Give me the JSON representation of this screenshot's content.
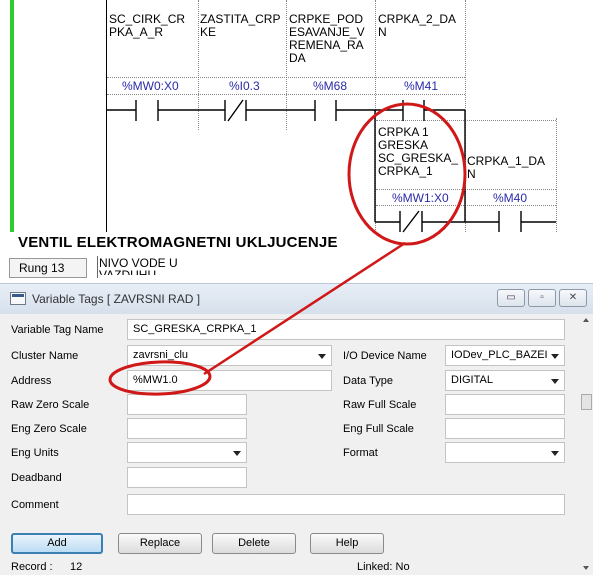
{
  "ladder": {
    "tags": [
      {
        "lines": [
          "SC_CIRK_CR",
          "PKA_A_R"
        ]
      },
      {
        "lines": [
          "ZASTITA_CRP",
          "KE"
        ]
      },
      {
        "lines": [
          "CRPKE_POD",
          "ESAVANJE_V",
          "REMENA_RA",
          "DA"
        ]
      },
      {
        "lines": [
          "CRPKA_2_DA",
          "N"
        ]
      }
    ],
    "addresses": [
      "%MW0:X0",
      "%I0.3",
      "%M68",
      "%M41"
    ],
    "branch_tags": [
      {
        "lines": [
          "CRPKA 1",
          "GRESKA",
          "SC_GRESKA_",
          "CRPKA_1"
        ]
      },
      {
        "lines": [
          "CRPKA_1_DA",
          "N"
        ]
      }
    ],
    "branch_addresses": [
      "%MW1:X0",
      "%M40"
    ],
    "section_title": "VENTIL ELEKTROMAGNETNI UKLJUCENJE",
    "rung_label": "Rung 13",
    "rung_comment": [
      "NIVO VODE U",
      "VAZDUHU..."
    ]
  },
  "dialog": {
    "title": "Variable Tags [ ZAVRSNI RAD ]",
    "window_buttons": {
      "minimize": "▭",
      "restore": "▫",
      "close": "✕"
    },
    "fields": {
      "variable_tag_name": {
        "label": "Variable Tag Name",
        "value": "SC_GRESKA_CRPKA_1"
      },
      "cluster_name": {
        "label": "Cluster Name",
        "value": "zavrsni_clu"
      },
      "io_device_name": {
        "label": "I/O Device Name",
        "value": "IODev_PLC_BAZEI"
      },
      "address": {
        "label": "Address",
        "value": "%MW1.0"
      },
      "data_type": {
        "label": "Data Type",
        "value": "DIGITAL"
      },
      "raw_zero_scale": {
        "label": "Raw Zero Scale",
        "value": ""
      },
      "raw_full_scale": {
        "label": "Raw Full Scale",
        "value": ""
      },
      "eng_zero_scale": {
        "label": "Eng Zero Scale",
        "value": ""
      },
      "eng_full_scale": {
        "label": "Eng Full Scale",
        "value": ""
      },
      "eng_units": {
        "label": "Eng Units",
        "value": ""
      },
      "format": {
        "label": "Format",
        "value": ""
      },
      "deadband": {
        "label": "Deadband",
        "value": ""
      },
      "comment": {
        "label": "Comment",
        "value": ""
      }
    },
    "buttons": {
      "add": "Add",
      "replace": "Replace",
      "delete": "Delete",
      "help": "Help"
    },
    "status": {
      "record_label": "Record :",
      "record_value": "12",
      "linked": "Linked: No"
    }
  },
  "colors": {
    "accent_green": "#2ecc2e",
    "annotation_red": "#d01818",
    "address_blue": "#2a2aa8",
    "titlebar": "#dbe4ee"
  }
}
